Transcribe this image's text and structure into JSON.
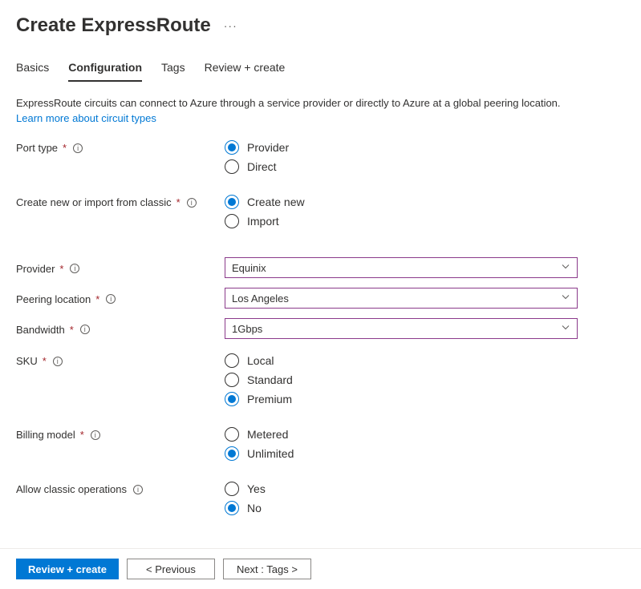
{
  "header": {
    "title": "Create ExpressRoute"
  },
  "tabs": {
    "basics": "Basics",
    "configuration": "Configuration",
    "tags": "Tags",
    "review": "Review + create"
  },
  "description": "ExpressRoute circuits can connect to Azure through a service provider or directly to Azure at a global peering location.",
  "learn_more": "Learn more about circuit types",
  "fields": {
    "port_type": {
      "label": "Port type",
      "options": {
        "provider": "Provider",
        "direct": "Direct"
      },
      "selected": "provider"
    },
    "create_import": {
      "label": "Create new or import from classic",
      "options": {
        "create": "Create new",
        "import": "Import"
      },
      "selected": "create"
    },
    "provider": {
      "label": "Provider",
      "value": "Equinix"
    },
    "peering_location": {
      "label": "Peering location",
      "value": "Los Angeles"
    },
    "bandwidth": {
      "label": "Bandwidth",
      "value": "1Gbps"
    },
    "sku": {
      "label": "SKU",
      "options": {
        "local": "Local",
        "standard": "Standard",
        "premium": "Premium"
      },
      "selected": "premium"
    },
    "billing_model": {
      "label": "Billing model",
      "options": {
        "metered": "Metered",
        "unlimited": "Unlimited"
      },
      "selected": "unlimited"
    },
    "classic_ops": {
      "label": "Allow classic operations",
      "options": {
        "yes": "Yes",
        "no": "No"
      },
      "selected": "no"
    }
  },
  "footer": {
    "review": "Review + create",
    "previous": "< Previous",
    "next": "Next : Tags >"
  }
}
